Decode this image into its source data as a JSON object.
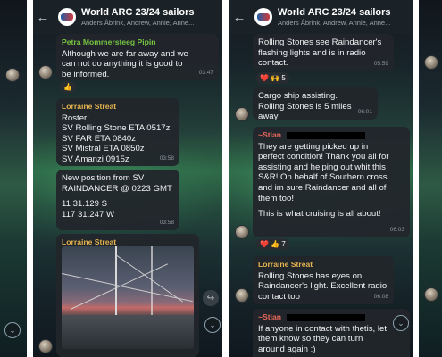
{
  "header": {
    "title": "World ARC 23/24 sailors",
    "subtitle": "Anders Åbrink, Andrew, Annie, Anne..."
  },
  "left_chat": {
    "msg1": {
      "sender": "Petra Mommersteeg Pipin",
      "lines": [
        "Although we are far away and we",
        "can not do anything it is good to",
        "be informed."
      ],
      "time": "03:47",
      "reaction": "👍"
    },
    "msg2": {
      "sender": "Lorraine Streat",
      "lines": [
        "Roster:",
        "SV Rolling Stone ETA 0517z",
        "SV FAR ETA 0840z",
        "SV Mistral ETA 0850z",
        "SV Amanzi 0915z"
      ],
      "time": "03:58"
    },
    "msg3": {
      "lines": [
        "New position from SV",
        "RAINDANCER @ 0223 GMT",
        "",
        "11 31.129 S",
        "117 31.247 W"
      ],
      "time": "03:58"
    },
    "msg4": {
      "sender": "Lorraine Streat"
    }
  },
  "right_chat": {
    "msg1": {
      "lines": [
        "Rolling Stones see Raindancer's",
        "flashing lights and is in radio",
        "contact."
      ],
      "time": "05:59",
      "reactions": [
        "❤️",
        "🙌",
        "5"
      ]
    },
    "msg2": {
      "lines": [
        "Cargo ship assisting.",
        "Rolling Stones is 5 miles away"
      ],
      "time": "06:01"
    },
    "msg3": {
      "sender": "~Stian",
      "lines": [
        "They are getting picked up in",
        "perfect condition! Thank you all for",
        "assisting and helping out whit this",
        "S&R! On behalf of Southern cross",
        "and im sure Raindancer and all of",
        "them too!",
        "",
        "This is what cruising is all about!"
      ],
      "time": "06:03",
      "reactions": [
        "❤️",
        "👍",
        "7"
      ]
    },
    "msg4": {
      "sender": "Lorraine Streat",
      "lines": [
        "Rolling Stones has eyes on",
        "Raindancer's light. Excellent radio",
        "contact too"
      ],
      "time": "06:08"
    },
    "msg5": {
      "sender": "~Stian",
      "lines": [
        "If anyone in contact with thetis, let",
        "them know so they can turn",
        "around again :)"
      ]
    }
  },
  "icons": {
    "back": "←",
    "forward": "↪",
    "scroll_down": "⌄"
  }
}
